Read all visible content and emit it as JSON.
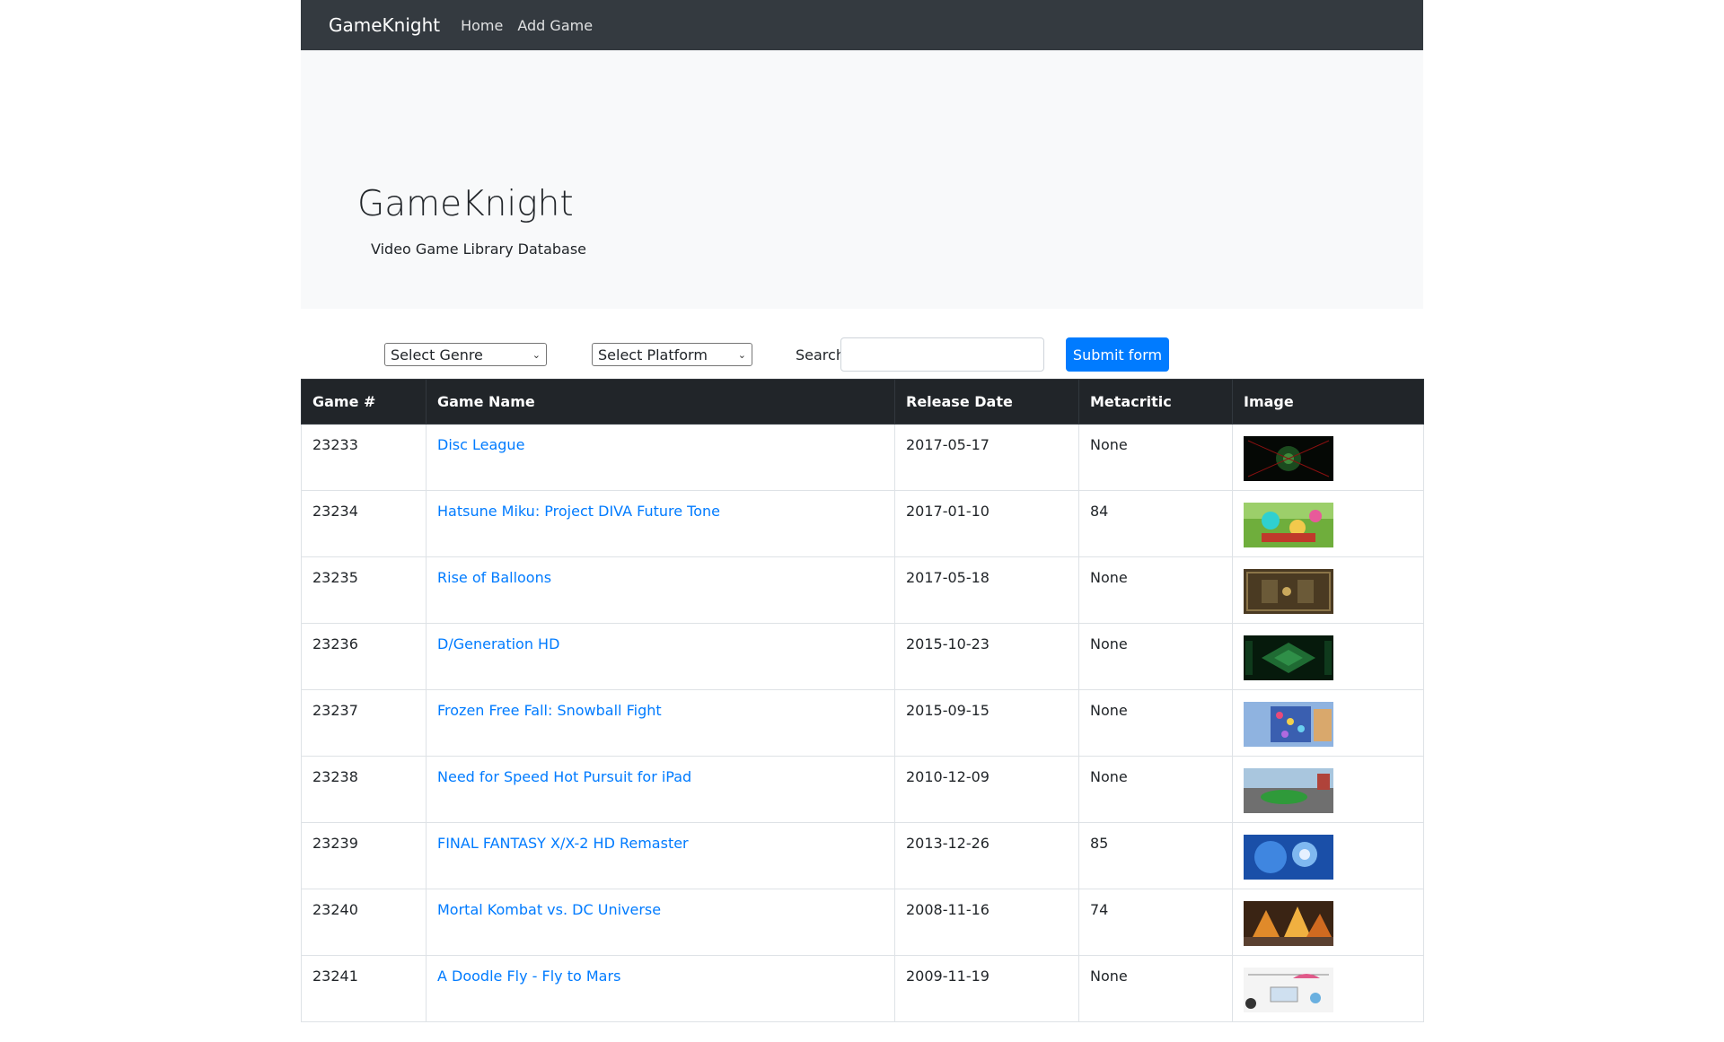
{
  "navbar": {
    "brand": "GameKnight",
    "links": [
      "Home",
      "Add Game"
    ]
  },
  "jumbotron": {
    "title": "GameKnight",
    "subtitle": "Video Game Library Database"
  },
  "filters": {
    "genre_select": "Select Genre",
    "platform_select": "Select Platform",
    "search_label": "Search:",
    "search_value": "",
    "submit_label": "Submit form"
  },
  "table": {
    "headers": [
      "Game #",
      "Game Name",
      "Release Date",
      "Metacritic",
      "Image"
    ],
    "rows": [
      {
        "id": "23233",
        "name": "Disc League",
        "release": "2017-05-17",
        "metacritic": "None",
        "thumb": "dark-green-arena"
      },
      {
        "id": "23234",
        "name": "Hatsune Miku: Project DIVA Future Tone",
        "release": "2017-01-10",
        "metacritic": "84",
        "thumb": "colorful-rhythm-game"
      },
      {
        "id": "23235",
        "name": "Rise of Balloons",
        "release": "2017-05-18",
        "metacritic": "None",
        "thumb": "brown-puzzle-board"
      },
      {
        "id": "23236",
        "name": "D/Generation HD",
        "release": "2015-10-23",
        "metacritic": "None",
        "thumb": "green-isometric-level"
      },
      {
        "id": "23237",
        "name": "Frozen Free Fall: Snowball Fight",
        "release": "2015-09-15",
        "metacritic": "None",
        "thumb": "blue-match-three"
      },
      {
        "id": "23238",
        "name": "Need for Speed Hot Pursuit for iPad",
        "release": "2010-12-09",
        "metacritic": "None",
        "thumb": "racing-car-road"
      },
      {
        "id": "23239",
        "name": "FINAL FANTASY X/X-2 HD Remaster",
        "release": "2013-12-26",
        "metacritic": "85",
        "thumb": "blue-character-art"
      },
      {
        "id": "23240",
        "name": "Mortal Kombat vs. DC Universe",
        "release": "2008-11-16",
        "metacritic": "74",
        "thumb": "fiery-arena"
      },
      {
        "id": "23241",
        "name": "A Doodle Fly - Fly to Mars",
        "release": "2009-11-19",
        "metacritic": "None",
        "thumb": "white-doodle-sketch"
      }
    ]
  },
  "colors": {
    "navbar": "#343a40",
    "jumbotron": "#f8f9fa",
    "table_header": "#212529",
    "link": "#007bff",
    "button": "#007bff"
  }
}
